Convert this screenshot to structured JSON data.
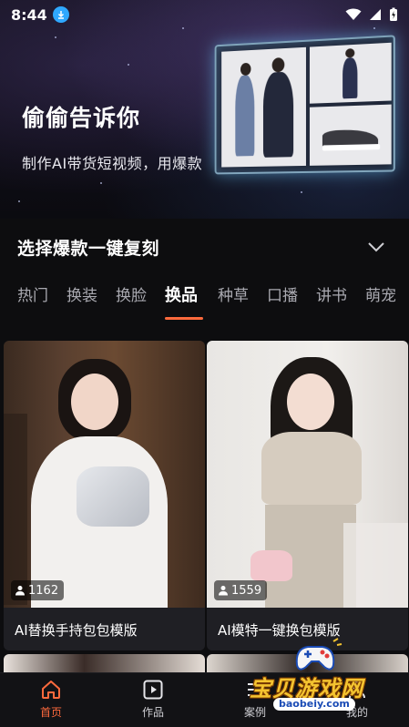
{
  "status_bar": {
    "time": "8:44"
  },
  "hero": {
    "title": "偷偷告诉你",
    "subtitle": "制作AI带货短视频，用爆款"
  },
  "section": {
    "title": "选择爆款一键复刻"
  },
  "tabs": [
    {
      "label": "热门",
      "active": false
    },
    {
      "label": "换装",
      "active": false
    },
    {
      "label": "换脸",
      "active": false
    },
    {
      "label": "换品",
      "active": true
    },
    {
      "label": "种草",
      "active": false
    },
    {
      "label": "口播",
      "active": false
    },
    {
      "label": "讲书",
      "active": false
    },
    {
      "label": "萌宠",
      "active": false
    }
  ],
  "cards": [
    {
      "views": "1162",
      "title": "AI替换手持包包模版"
    },
    {
      "views": "1559",
      "title": "AI模特一键换包模版"
    }
  ],
  "bottom_nav": [
    {
      "label": "首页",
      "icon": "home-icon",
      "active": true
    },
    {
      "label": "作品",
      "icon": "play-icon",
      "active": false
    },
    {
      "label": "案例",
      "icon": "list-icon",
      "active": false
    },
    {
      "label": "我的",
      "icon": "person-icon",
      "active": false
    }
  ],
  "watermark": {
    "text": "宝贝游戏网",
    "url": "baobeiy.com"
  },
  "colors": {
    "accent": "#ff6a3d",
    "background": "#0d0d0f",
    "download_badge": "#2fa8ff"
  }
}
